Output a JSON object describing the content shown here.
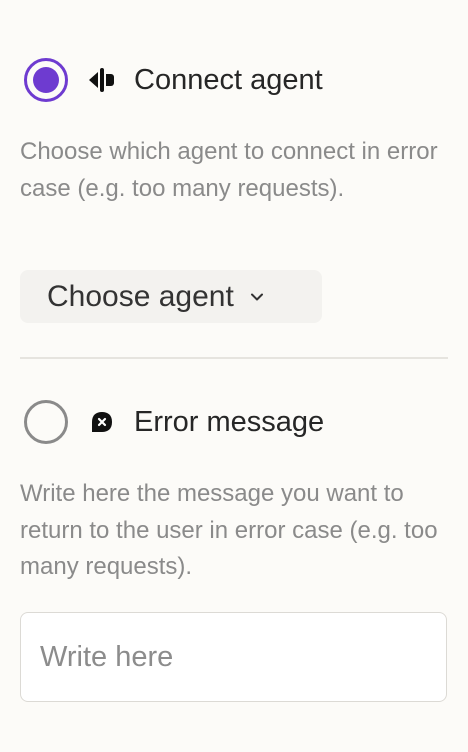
{
  "options": [
    {
      "label": "Connect agent",
      "icon": "agent-connect-icon",
      "selected": true,
      "description": "Choose which agent to connect in error case (e.g. too many requests)."
    },
    {
      "label": "Error message",
      "icon": "error-message-icon",
      "selected": false,
      "description": "Write here the message you want to return to the user in error case (e.g. too many requests)."
    }
  ],
  "agent_select": {
    "label": "Choose agent",
    "icon": "chevron-down-icon"
  },
  "message_input": {
    "placeholder": "Write here",
    "value": ""
  },
  "colors": {
    "accent": "#6e3bd0",
    "background": "#fcfbf8",
    "muted_text": "#8a8a8a"
  }
}
